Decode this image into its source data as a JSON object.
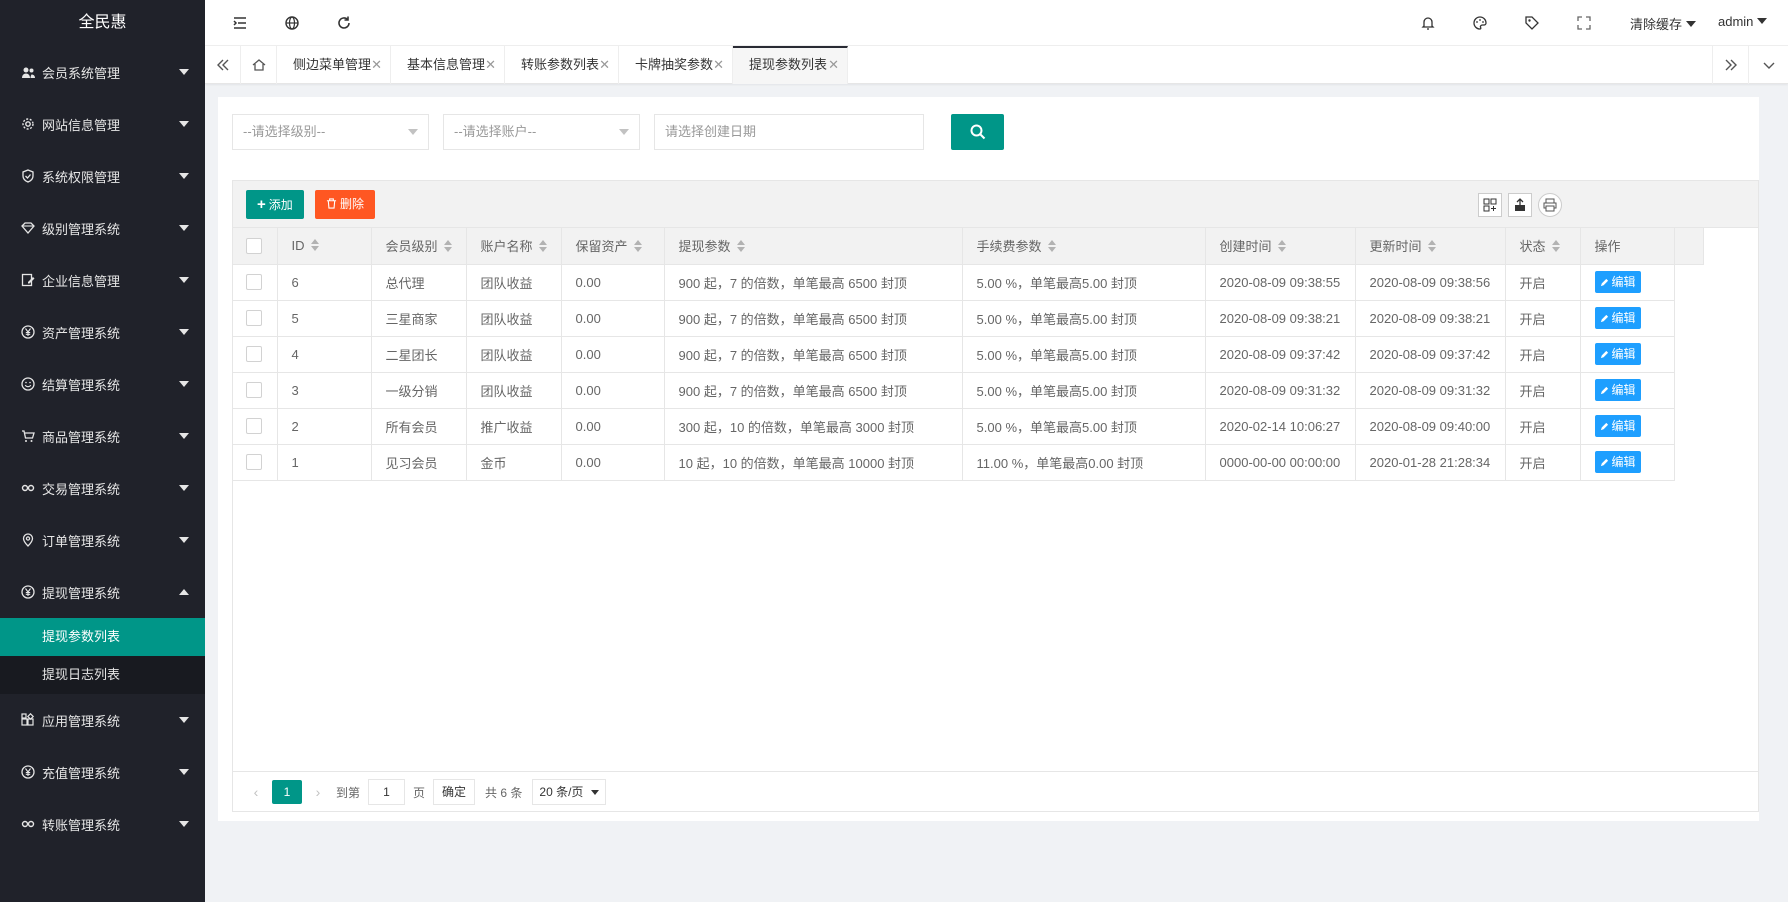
{
  "app": {
    "title": "全民惠",
    "logo_cut_text": "主页"
  },
  "sidebar": {
    "items": [
      {
        "label": "会员系统管理",
        "icon": "users-icon"
      },
      {
        "label": "网站信息管理",
        "icon": "gear-icon"
      },
      {
        "label": "系统权限管理",
        "icon": "shield-icon"
      },
      {
        "label": "级别管理系统",
        "icon": "diamond-icon"
      },
      {
        "label": "企业信息管理",
        "icon": "edit-doc-icon"
      },
      {
        "label": "资产管理系统",
        "icon": "yen-icon"
      },
      {
        "label": "结算管理系统",
        "icon": "smile-icon"
      },
      {
        "label": "商品管理系统",
        "icon": "cart-icon"
      },
      {
        "label": "交易管理系统",
        "icon": "link-icon"
      },
      {
        "label": "订单管理系统",
        "icon": "location-icon"
      },
      {
        "label": "提现管理系统",
        "icon": "yen-icon"
      }
    ],
    "subitems": [
      {
        "label": "提现参数列表"
      },
      {
        "label": "提现日志列表"
      }
    ],
    "items_after": [
      {
        "label": "应用管理系统",
        "icon": "apps-icon"
      },
      {
        "label": "充值管理系统",
        "icon": "yen-icon"
      },
      {
        "label": "转账管理系统",
        "icon": "link-icon"
      }
    ]
  },
  "header": {
    "clear_cache": "清除缓存",
    "user": "admin"
  },
  "tabs": [
    {
      "label": "侧边菜单管理"
    },
    {
      "label": "基本信息管理"
    },
    {
      "label": "转账参数列表"
    },
    {
      "label": "卡牌抽奖参数"
    },
    {
      "label": "提现参数列表"
    }
  ],
  "search": {
    "level_placeholder": "--请选择级别--",
    "account_placeholder": "--请选择账户--",
    "date_placeholder": "请选择创建日期"
  },
  "toolbar": {
    "add_label": "添加",
    "delete_label": "删除"
  },
  "table": {
    "headers": [
      "ID",
      "会员级别",
      "账户名称",
      "保留资产",
      "提现参数",
      "手续费参数",
      "创建时间",
      "更新时间",
      "状态",
      "操作"
    ],
    "edit_label": "编辑",
    "rows": [
      {
        "id": "6",
        "level": "总代理",
        "account": "团队收益",
        "reserve": "0.00",
        "withdraw": "900 起，7 的倍数，单笔最高 6500 封顶",
        "fee": "5.00 %，单笔最高5.00 封顶",
        "created": "2020-08-09 09:38:55",
        "updated": "2020-08-09 09:38:56",
        "status": "开启"
      },
      {
        "id": "5",
        "level": "三星商家",
        "account": "团队收益",
        "reserve": "0.00",
        "withdraw": "900 起，7 的倍数，单笔最高 6500 封顶",
        "fee": "5.00 %，单笔最高5.00 封顶",
        "created": "2020-08-09 09:38:21",
        "updated": "2020-08-09 09:38:21",
        "status": "开启"
      },
      {
        "id": "4",
        "level": "二星团长",
        "account": "团队收益",
        "reserve": "0.00",
        "withdraw": "900 起，7 的倍数，单笔最高 6500 封顶",
        "fee": "5.00 %，单笔最高5.00 封顶",
        "created": "2020-08-09 09:37:42",
        "updated": "2020-08-09 09:37:42",
        "status": "开启"
      },
      {
        "id": "3",
        "level": "一级分销",
        "account": "团队收益",
        "reserve": "0.00",
        "withdraw": "900 起，7 的倍数，单笔最高 6500 封顶",
        "fee": "5.00 %，单笔最高5.00 封顶",
        "created": "2020-08-09 09:31:32",
        "updated": "2020-08-09 09:31:32",
        "status": "开启"
      },
      {
        "id": "2",
        "level": "所有会员",
        "account": "推广收益",
        "reserve": "0.00",
        "withdraw": "300 起，10 的倍数，单笔最高 3000 封顶",
        "fee": "5.00 %，单笔最高5.00 封顶",
        "created": "2020-02-14 10:06:27",
        "updated": "2020-08-09 09:40:00",
        "status": "开启"
      },
      {
        "id": "1",
        "level": "见习会员",
        "account": "金币",
        "reserve": "0.00",
        "withdraw": "10 起，10 的倍数，单笔最高 10000 封顶",
        "fee": "11.00 %，单笔最高0.00 封顶",
        "created": "0000-00-00 00:00:00",
        "updated": "2020-01-28 21:28:34",
        "status": "开启"
      }
    ]
  },
  "pager": {
    "current": "1",
    "goto_label": "到第",
    "page_value": "1",
    "page_unit": "页",
    "confirm_label": "确定",
    "total": "共 6 条",
    "limit": "20 条/页"
  },
  "colors": {
    "primary": "#009688",
    "danger": "#ff5722",
    "info": "#1e9fff",
    "sidebar": "#20222a"
  }
}
